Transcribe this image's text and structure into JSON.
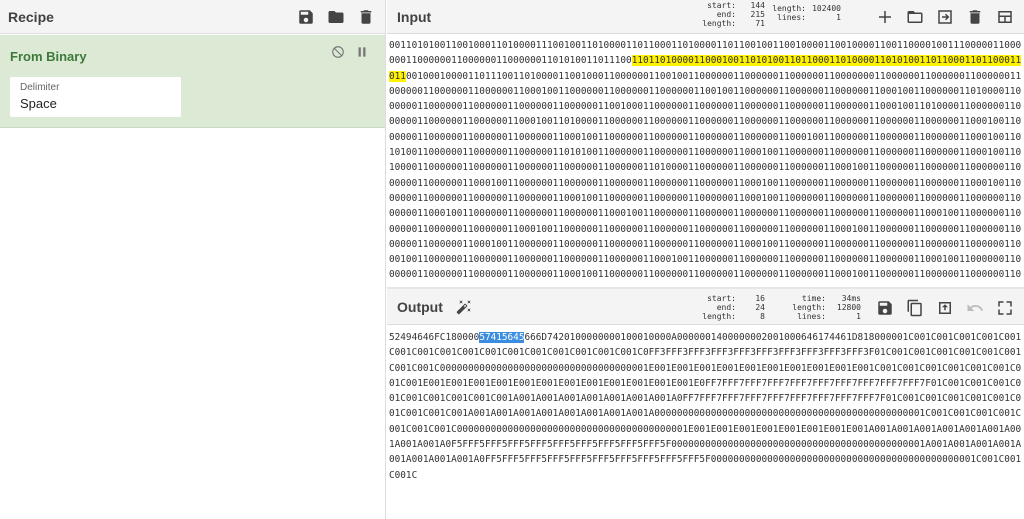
{
  "recipe": {
    "title": "Recipe",
    "operation": {
      "name": "From Binary",
      "arg_label": "Delimiter",
      "arg_value": "Space"
    }
  },
  "input": {
    "title": "Input",
    "stats": {
      "start_label": "start:",
      "start": "144",
      "end_label": "end:",
      "end": "215",
      "len_label": "length:",
      "len": "71",
      "length_label": "length:",
      "length": "102400",
      "lines_label": "lines:",
      "lines": "1"
    },
    "text_before": "00110101001100100011010000111001001101000011011000110100001101100100110010000110010000110011000010011100000110000001100000011000000110000001101010011011100",
    "text_highlight": "110110100001100010011010100110110001101000011010100110110001101100011011",
    "text_after": "00100010000110111001101000011001000110000001100100110000001100000011000000110000000110000001100000011000000110000001100000011000000110001001100000011000000110000001100100110000001100000011000000110001001100000011010000110000001100000011000000110000001100000011001000110000001100000011000000110000001100000011000100110100001100000011000000110000001100000011000100110100001100000011000000110000001100000011000000110000001100000011000000110001001100000011000000110000001100000011000100110000001100000011000000110000001100010011000000110000001100000011000100110101001100000011000000110000001101010011000000110000001100000011000100110000001100000011000000110000001100010011010000110000001100000011000000110000001100000011010000110000001100000011000000110001001100000011000000110000001100000011000000110001001100000011000000110000001100000011000000110001001100000011000000110000001100000011000100110000001100000011000000110000001100010011000000110000001100000011000100110000001100000011000000110000001100000011000000110001001100000011000000110000001100010011000000110000001100000011000000110000001100000011000100110000001100000011000000110000001100010011000000110000001100000011000000110000001100000011000100110000001100000011000000110000001100000011000100110000001100000011000000110000001100000011000100110000001100000011000000110000001100000011000100110000001100000011000000110000001100000011000100110000001100000011000000110000001100000011000100110000001100000011000000110000001100000011000100110000001100000011000000110000001100000011000100110000001100000011000000110000001100000011000100110000001100000011000000110000001100000011000100110000001100000011000000110000001100000011000100110000001100000011000000110000001100000011000100110000001100000011000000110000"
  },
  "output": {
    "title": "Output",
    "stats": {
      "start_label": "start:",
      "start": "16",
      "end_label": "end:",
      "end": "24",
      "len_label": "length:",
      "len": "8",
      "time_label": "time:",
      "time": "34ms",
      "length_label": "length:",
      "length": "12800",
      "lines_label": "lines:",
      "lines": "1"
    },
    "text_before": "52494646FC180000",
    "text_highlight": "57415645",
    "text_after": "666D7420100000000100010000A0000001400000002001000646174461D818000001C001C001C001C001C001C001C001C001C001C001C001C001C001C001C001C001C0FF3FFF3FFF3FFF3FFF3FFF3FFF3FFF3FFF3FFF3F01C001C001C001C001C001C001C001C001C0000000000000000000000000000000000001E001E001E001E001E001E001E001E001E001E001C001C001C001C001C001C001C001C001E001E001E001E001E001E001E001E001E001E001E001E001E0FF7FFF7FFF7FFF7FFF7FFF7FFF7FFF7FFF7FFF7F01C001C001C001C001C001C001C001C001C001A001A001A001A001A001A001A001A0FF7FFF7FFF7FFF7FFF7FFF7FFF7FFF7FFF7F01C001C001C001C001C001C001C001C001C001A001A001A001A001A001A001A001A001A000000000000000000000000000000000000000000000001C001C001C001C001C001C001C001C00000000000000000000000000000000000000001E001E001E001E001E001E001E001E001A001A001A001A001A001A001A001A001A001A0F5FFF5FFF5FFF5FFF5FFF5FFF5FFF5FFF5FFF5F000000000000000000000000000000000000000000001A001A001A001A001A001A001A001A001A0FF5FFF5FFF5FFF5FFF5FFF5FFF5FFF5FFF5FFF5F00000000000000000000000000000000000000000000001C001C001C001C"
  }
}
